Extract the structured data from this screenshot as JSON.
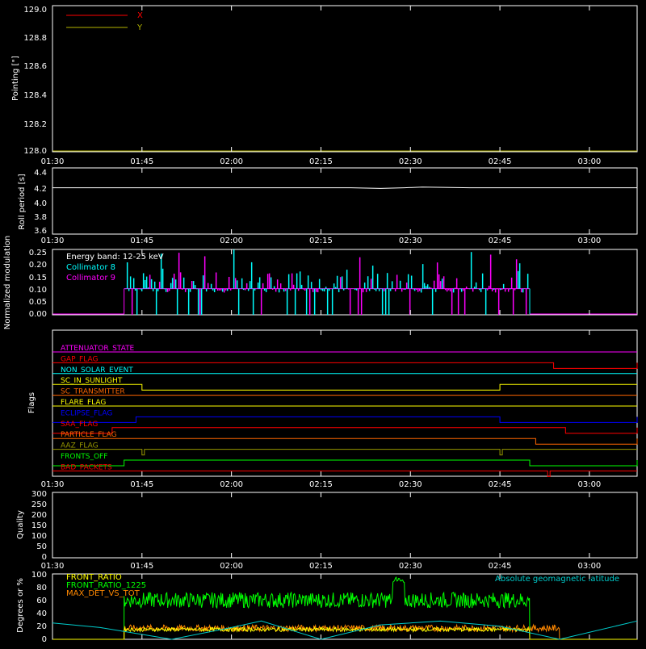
{
  "chart_data": [
    {
      "type": "line",
      "ylabel": "Pointing [\"]",
      "ylim": [
        128.0,
        129.0
      ],
      "yticks": [
        "128.0",
        "128.2",
        "128.4",
        "128.6",
        "128.8",
        "129.0"
      ],
      "series": [
        {
          "name": "X",
          "color": "#ff0000",
          "values": []
        },
        {
          "name": "Y",
          "color": "#b3b300",
          "values": []
        }
      ]
    },
    {
      "type": "line",
      "ylabel": "Roll period [s]",
      "ylim": [
        3.5,
        4.5
      ],
      "yticks": [
        "3.6",
        "3.8",
        "4.0",
        "4.2",
        "4.4"
      ],
      "series": [
        {
          "color": "#ffffff",
          "x": [
            "01:30",
            "01:40",
            "01:50",
            "02:00",
            "02:10",
            "02:20",
            "02:25",
            "02:29",
            "02:32",
            "02:40",
            "02:50",
            "03:00",
            "03:08"
          ],
          "values": [
            4.2,
            4.2,
            4.2,
            4.2,
            4.2,
            4.2,
            4.19,
            4.2,
            4.21,
            4.2,
            4.2,
            4.2,
            4.2
          ]
        }
      ]
    },
    {
      "type": "bar",
      "ylabel": "Normalized modulation",
      "ylim": [
        0.0,
        0.25
      ],
      "yticks": [
        "0.00",
        "0.05",
        "0.10",
        "0.15",
        "0.20",
        "0.25"
      ],
      "annotation": "Energy band: 12-25 keV",
      "active_range": [
        "01:42",
        "02:50"
      ],
      "baseline": 0.1,
      "series": [
        {
          "name": "Collimator 8",
          "color": "#00ffff"
        },
        {
          "name": "Collimator 9",
          "color": "#ff00ff"
        }
      ]
    },
    {
      "type": "line",
      "ylabel": "Flags",
      "flags": [
        {
          "name": "ATTENUATOR_STATE",
          "color": "#ff00ff",
          "high": []
        },
        {
          "name": "GAP_FLAG",
          "color": "#ff0000",
          "high": [
            [
              "02:54",
              "03:08"
            ]
          ]
        },
        {
          "name": "NON_SOLAR_EVENT",
          "color": "#00ffff",
          "high": []
        },
        {
          "name": "SC_IN_SUNLIGHT",
          "color": "#ffff00",
          "high": [
            [
              "01:45",
              "02:45"
            ]
          ]
        },
        {
          "name": "SC_TRANSMITTER",
          "color": "#ff6600",
          "high": []
        },
        {
          "name": "FLARE_FLAG",
          "color": "#ffff00",
          "high": []
        },
        {
          "name": "ECLIPSE_FLAG",
          "color": "#0000ff",
          "high": [
            [
              "01:30",
              "01:44"
            ],
            [
              "02:45",
              "03:08"
            ]
          ]
        },
        {
          "name": "SAA_FLAG",
          "color": "#ff0000",
          "high": [
            [
              "01:30",
              "01:40"
            ],
            [
              "02:56",
              "03:08"
            ]
          ]
        },
        {
          "name": "PARTICLE_FLAG",
          "color": "#ff6600",
          "high": [
            [
              "02:51",
              "03:08"
            ]
          ]
        },
        {
          "name": "AAZ_FLAG",
          "color": "#999900",
          "high": [
            [
              "01:45",
              "01:45"
            ],
            [
              "02:45",
              "02:45"
            ]
          ]
        },
        {
          "name": "FRONTS_OFF",
          "color": "#00ff00",
          "high": [
            [
              "01:30",
              "01:42"
            ],
            [
              "02:50",
              "03:08"
            ]
          ]
        },
        {
          "name": "BAD_PACKETS",
          "color": "#ff0000",
          "high": [
            [
              "02:53",
              "02:53"
            ]
          ]
        }
      ]
    },
    {
      "type": "line",
      "ylabel": "Quality",
      "ylim": [
        0,
        300
      ],
      "yticks": [
        "0",
        "50",
        "100",
        "150",
        "200",
        "250",
        "300"
      ],
      "series": []
    },
    {
      "type": "line",
      "ylabel": "Degrees or %",
      "ylim": [
        0,
        100
      ],
      "yticks": [
        "0",
        "20",
        "40",
        "60",
        "80",
        "100"
      ],
      "series": [
        {
          "name": "FRONT_RATIO",
          "color": "#ffff00",
          "active_range": [
            "01:42",
            "02:50"
          ],
          "mean": 15
        },
        {
          "name": "FRONT_RATIO_1225",
          "color": "#00ff00",
          "active_range": [
            "01:42",
            "02:50"
          ],
          "mean": 60,
          "spike": [
            "02:27",
            "02:29",
            95
          ]
        },
        {
          "name": "MAX_DET_VS_TOT",
          "color": "#ff8800",
          "active_range": [
            "01:42",
            "02:55"
          ],
          "mean": 17
        },
        {
          "name": "Absolute geomagnetic latitude",
          "color": "#00cccc",
          "x": [
            "01:30",
            "01:38",
            "01:50",
            "02:00",
            "02:05",
            "02:15",
            "02:25",
            "02:35",
            "02:45",
            "02:55",
            "03:08"
          ],
          "values": [
            25,
            18,
            0,
            18,
            28,
            0,
            22,
            28,
            20,
            0,
            28
          ]
        }
      ]
    }
  ],
  "time_axis": {
    "range": [
      "01:30",
      "03:08"
    ],
    "ticks": [
      "01:30",
      "01:45",
      "02:00",
      "02:15",
      "02:30",
      "02:45",
      "03:00"
    ]
  }
}
